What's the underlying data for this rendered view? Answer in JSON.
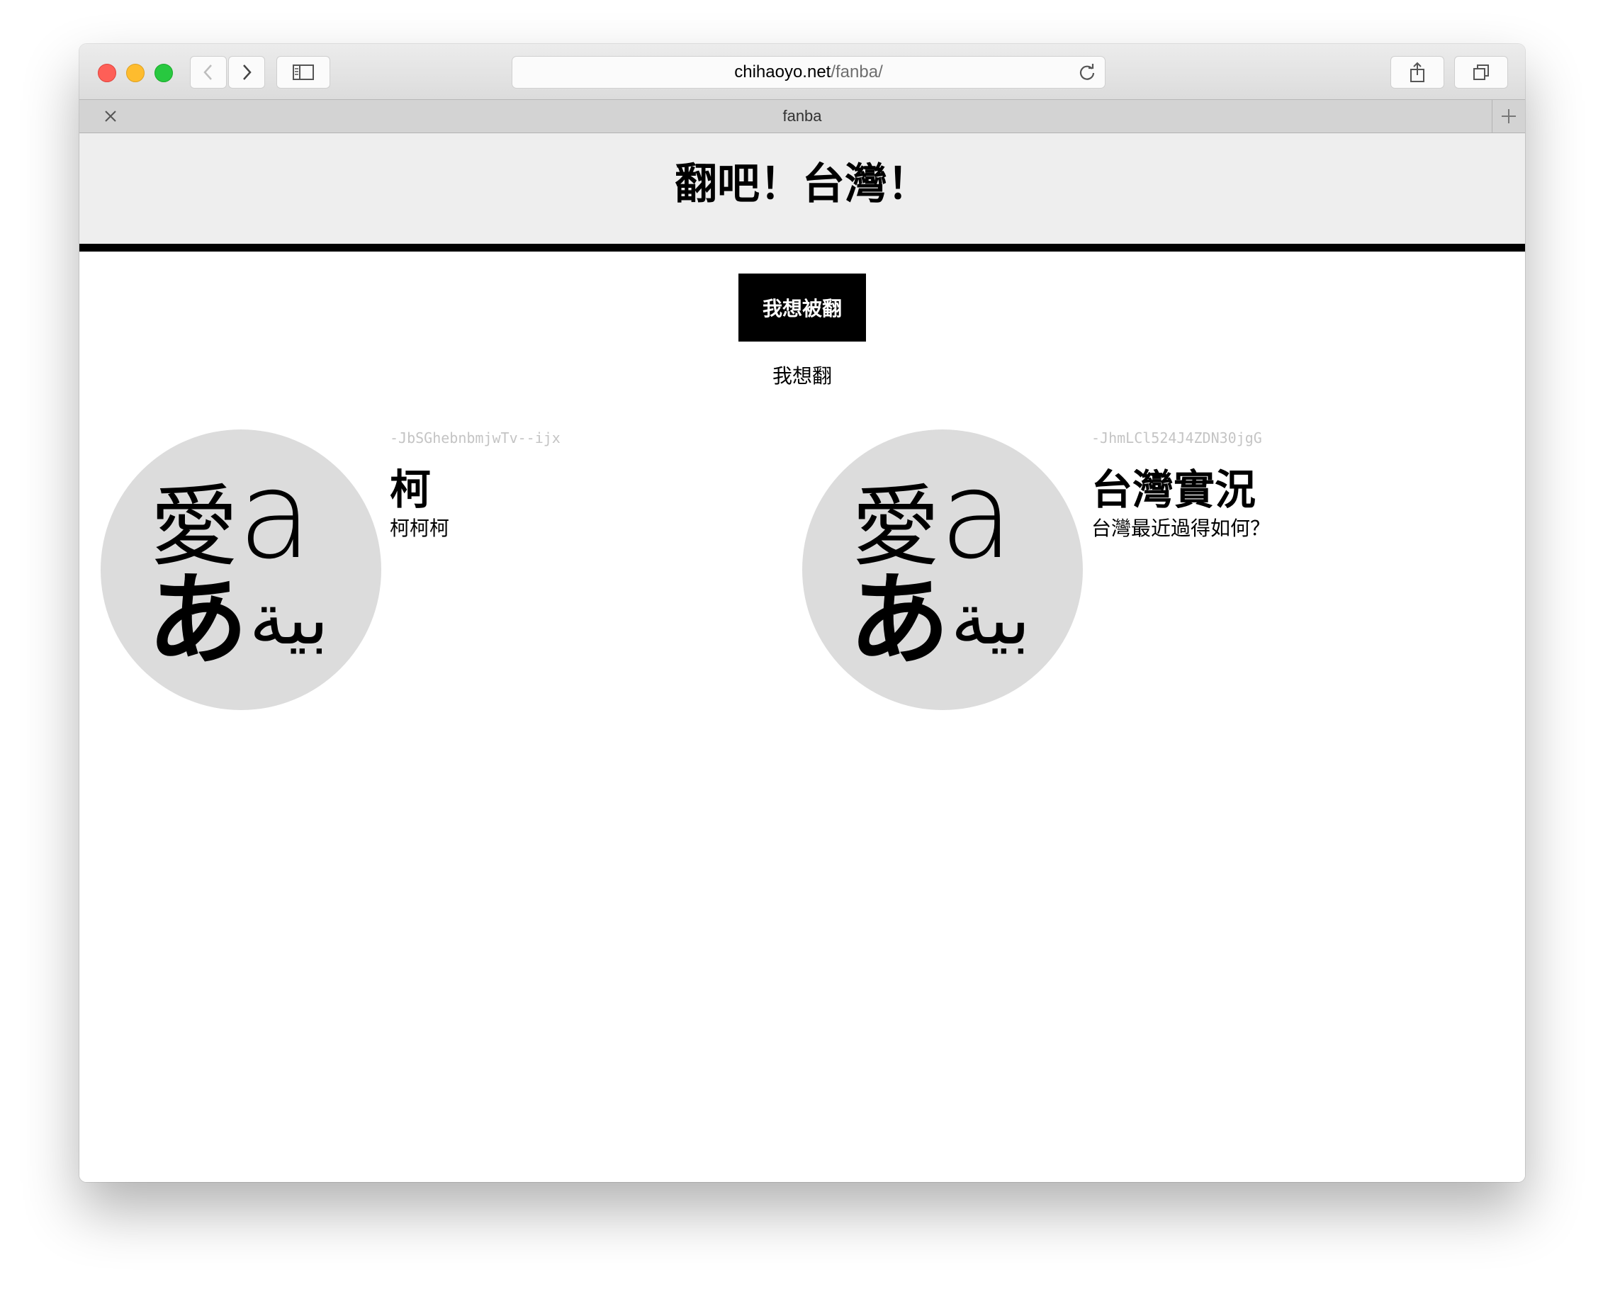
{
  "browser": {
    "url_domain": "chihaoyo.net",
    "url_path": "/fanba/",
    "tab_title": "fanba"
  },
  "site": {
    "title": "翻吧！台灣！",
    "primary_button": "我想被翻",
    "secondary_link": "我想翻"
  },
  "avatar_glyphs": {
    "top_left": "愛",
    "top_right": "a",
    "bottom_left": "あ",
    "bottom_right": "بية"
  },
  "cards": [
    {
      "id": "-JbSGhebnbmjwTv--ijx",
      "title": "柯",
      "description": "柯柯柯"
    },
    {
      "id": "-JhmLCl524J4ZDN30jgG",
      "title": "台灣實況",
      "description": "台灣最近過得如何？"
    }
  ],
  "colors": {
    "header_bg": "#eeeeee",
    "avatar_bg": "#dcdcdc",
    "id_text": "#c4c4c4"
  }
}
